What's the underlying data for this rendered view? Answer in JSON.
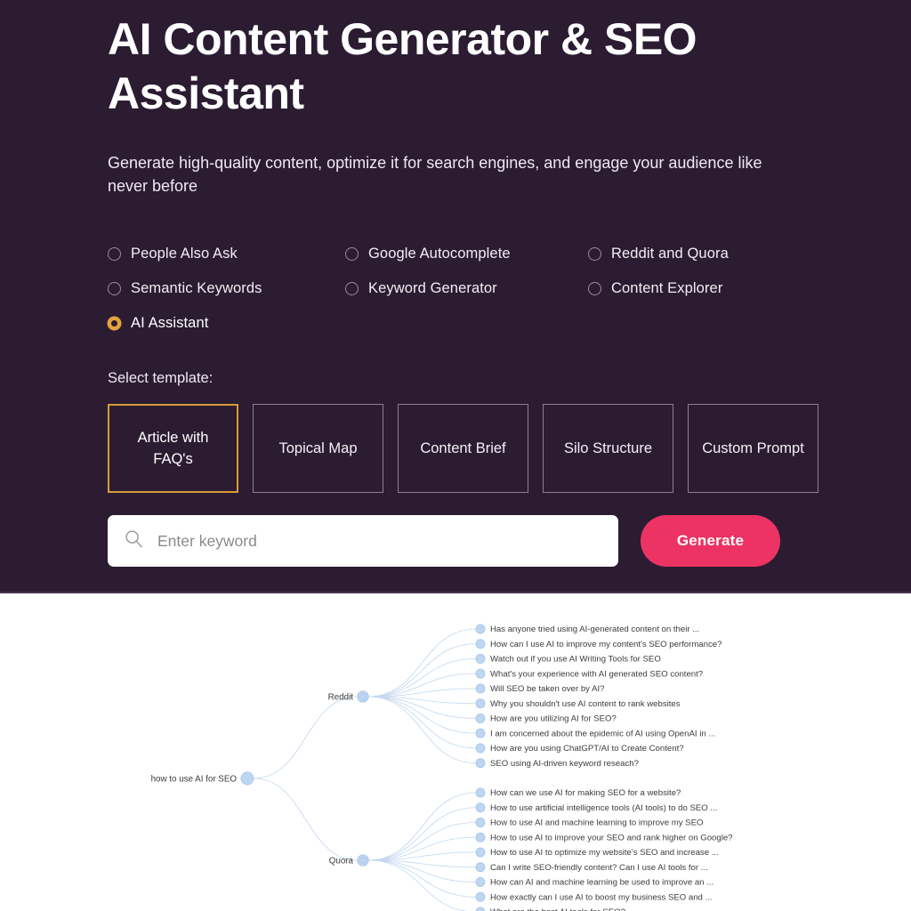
{
  "hero": {
    "title": "AI Content Generator & SEO Assistant",
    "subtitle": "Generate high-quality content, optimize it for search engines, and engage your audience like never before"
  },
  "modes": {
    "selected": "AI Assistant",
    "options": [
      {
        "label": "People Also Ask",
        "selected": false
      },
      {
        "label": "Google Autocomplete",
        "selected": false
      },
      {
        "label": "Reddit and Quora",
        "selected": false
      },
      {
        "label": "Semantic Keywords",
        "selected": false
      },
      {
        "label": "Keyword Generator",
        "selected": false
      },
      {
        "label": "Content Explorer",
        "selected": false
      },
      {
        "label": "AI Assistant",
        "selected": true
      }
    ]
  },
  "templates": {
    "label": "Select template:",
    "selected": "Article with FAQ's",
    "items": [
      {
        "label": "Article with FAQ's",
        "active": true
      },
      {
        "label": "Topical Map",
        "active": false
      },
      {
        "label": "Content Brief",
        "active": false
      },
      {
        "label": "Silo Structure",
        "active": false
      },
      {
        "label": "Custom Prompt",
        "active": false
      }
    ]
  },
  "search": {
    "placeholder": "Enter keyword",
    "value": "",
    "icon": "search-icon",
    "generate_label": "Generate"
  },
  "colors": {
    "hero_background": "#2b1c32",
    "accent_amber": "#d99b35",
    "accent_pink": "#ec3363",
    "node_blue": "#bfd6f2",
    "edge_blue": "#c3d8f0"
  },
  "tree": {
    "root": "how to use AI for SEO",
    "branches": [
      {
        "name": "Reddit",
        "leaves": [
          "Has anyone tried using AI-generated content on their ...",
          "How can I use AI to improve my content's SEO performance?",
          "Watch out if you use AI Writing Tools for SEO",
          "What's your experience with AI generated SEO content?",
          "Will SEO be taken over by AI?",
          "Why you shouldn't use AI content to rank websites",
          "How are you utilizing AI for SEO?",
          "I am concerned about the epidemic of AI using OpenAI in ...",
          "How are you using ChatGPT/AI to Create Content?",
          "SEO using AI-driven keyword reseach?"
        ]
      },
      {
        "name": "Quora",
        "leaves": [
          "How can we use AI for making SEO for a website?",
          "How to use artificial intelligence tools (AI tools) to do SEO ...",
          "How to use AI and machine learning to improve my SEO",
          "How to use AI to improve your SEO and rank higher on Google?",
          "How to use AI to optimize my website's SEO and increase ...",
          "Can I write SEO-friendly content? Can I use AI tools for ...",
          "How can AI and machine learning be used to improve an ...",
          "How exactly can I use AI to boost my business SEO and ...",
          "What are the best AI tools for SEO?"
        ]
      }
    ]
  }
}
